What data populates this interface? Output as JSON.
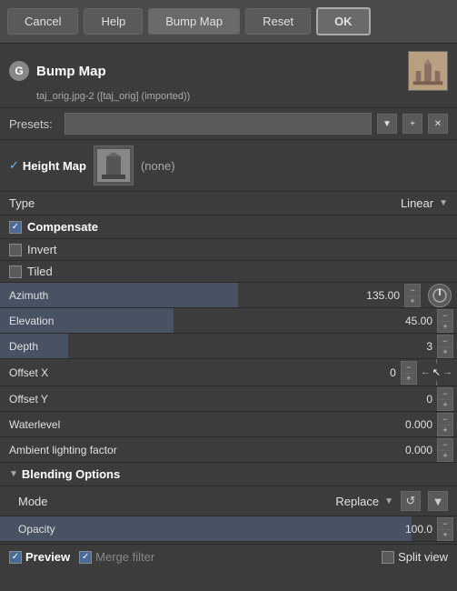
{
  "toolbar": {
    "cancel_label": "Cancel",
    "help_label": "Help",
    "bumpmap_label": "Bump Map",
    "reset_label": "Reset",
    "ok_label": "OK"
  },
  "header": {
    "title": "Bump Map",
    "subtitle": "taj_orig.jpg-2 ([taj_orig] (imported))",
    "logo": "G"
  },
  "presets": {
    "label": "Presets:",
    "placeholder": "",
    "add_icon": "+",
    "remove_icon": "✕",
    "arrow": "▼"
  },
  "heightmap": {
    "label": "Height Map",
    "checked": true,
    "none_label": "(none)"
  },
  "type": {
    "label": "Type",
    "value": "Linear",
    "arrow": "▼"
  },
  "compensate": {
    "label": "Compensate",
    "checked": true
  },
  "invert": {
    "label": "Invert",
    "checked": false
  },
  "tiled": {
    "label": "Tiled",
    "checked": false
  },
  "azimuth": {
    "label": "Azimuth",
    "value": "135.00",
    "fill_pct": 52
  },
  "elevation": {
    "label": "Elevation",
    "value": "45.00",
    "fill_pct": 38
  },
  "depth": {
    "label": "Depth",
    "value": "3",
    "fill_pct": 15
  },
  "offset_x": {
    "label": "Offset X",
    "value": "0",
    "fill_pct": 0
  },
  "offset_y": {
    "label": "Offset Y",
    "value": "0",
    "fill_pct": 0
  },
  "waterlevel": {
    "label": "Waterlevel",
    "value": "0.000",
    "fill_pct": 0
  },
  "ambient": {
    "label": "Ambient lighting factor",
    "value": "0.000",
    "fill_pct": 0
  },
  "blending_options": {
    "label": "Blending Options"
  },
  "mode": {
    "label": "Mode",
    "value": "Replace",
    "arrow": "▼"
  },
  "opacity": {
    "label": "Opacity",
    "value": "100.0",
    "fill_pct": 90
  },
  "footer": {
    "preview_checked": true,
    "preview_label": "Preview",
    "merge_checked": true,
    "merge_label": "Merge filter",
    "split_label": "Split view"
  }
}
